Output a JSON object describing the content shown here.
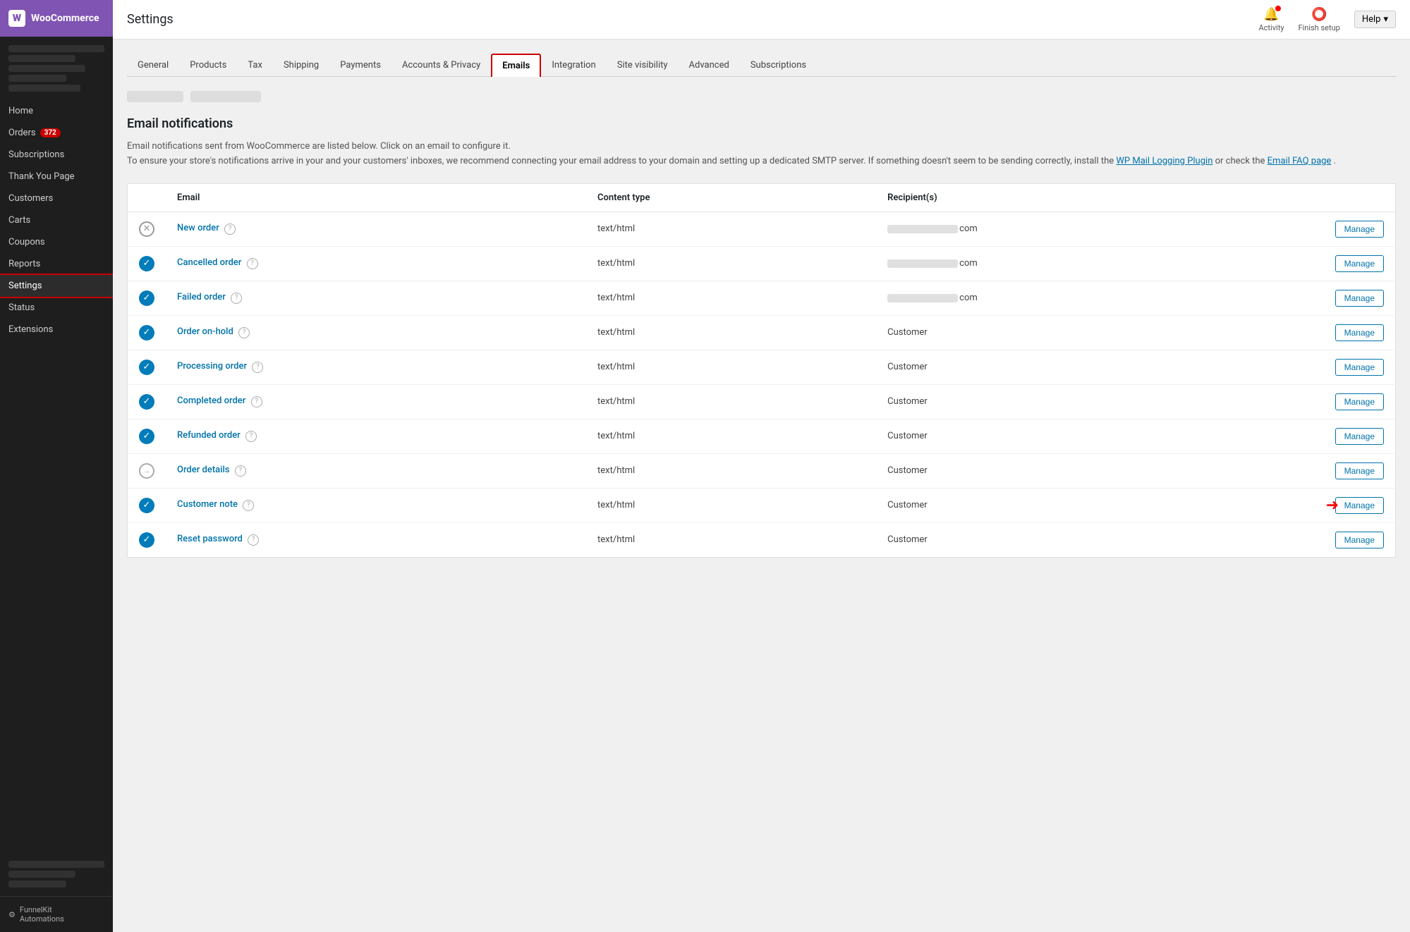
{
  "sidebar": {
    "logo_label": "WooCommerce",
    "logo_initial": "W",
    "nav_items": [
      {
        "id": "home",
        "label": "Home",
        "active": false
      },
      {
        "id": "orders",
        "label": "Orders",
        "badge": "372",
        "active": false
      },
      {
        "id": "subscriptions",
        "label": "Subscriptions",
        "active": false
      },
      {
        "id": "thank-you-page",
        "label": "Thank You Page",
        "active": false
      },
      {
        "id": "customers",
        "label": "Customers",
        "active": false
      },
      {
        "id": "carts",
        "label": "Carts",
        "active": false
      },
      {
        "id": "coupons",
        "label": "Coupons",
        "active": false
      },
      {
        "id": "reports",
        "label": "Reports",
        "active": false
      },
      {
        "id": "settings",
        "label": "Settings",
        "active": true,
        "settings": true
      },
      {
        "id": "status",
        "label": "Status",
        "active": false
      },
      {
        "id": "extensions",
        "label": "Extensions",
        "active": false
      }
    ],
    "footer_label": "FunnelKit Automations",
    "footer_icon": "⚙"
  },
  "topbar": {
    "title": "Settings",
    "activity_label": "Activity",
    "finish_setup_label": "Finish setup",
    "help_label": "Help"
  },
  "tabs": [
    {
      "id": "general",
      "label": "General",
      "active": false
    },
    {
      "id": "products",
      "label": "Products",
      "active": false
    },
    {
      "id": "tax",
      "label": "Tax",
      "active": false
    },
    {
      "id": "shipping",
      "label": "Shipping",
      "active": false
    },
    {
      "id": "payments",
      "label": "Payments",
      "active": false
    },
    {
      "id": "accounts-privacy",
      "label": "Accounts & Privacy",
      "active": false
    },
    {
      "id": "emails",
      "label": "Emails",
      "active": true
    },
    {
      "id": "integration",
      "label": "Integration",
      "active": false
    },
    {
      "id": "site-visibility",
      "label": "Site visibility",
      "active": false
    },
    {
      "id": "advanced",
      "label": "Advanced",
      "active": false
    },
    {
      "id": "subscriptions-tab",
      "label": "Subscriptions",
      "active": false
    }
  ],
  "section": {
    "title": "Email notifications",
    "description_part1": "Email notifications sent from WooCommerce are listed below. Click on an email to configure it.",
    "description_part2": "To ensure your store's notifications arrive in your and your customers' inboxes, we recommend connecting your email address to your domain and setting up a dedicated SMTP server. If something doesn't seem to be sending correctly, install the ",
    "link1_text": "WP Mail Logging Plugin",
    "description_part3": " or check the ",
    "link2_text": "Email FAQ page",
    "description_part4": "."
  },
  "table": {
    "col_email": "Email",
    "col_content_type": "Content type",
    "col_recipients": "Recipient(s)",
    "rows": [
      {
        "id": "new-order",
        "status": "disabled",
        "name": "New order",
        "content_type": "text/html",
        "recipient": "blurred",
        "recipient_suffix": "com",
        "manage_label": "Manage"
      },
      {
        "id": "cancelled-order",
        "status": "enabled",
        "name": "Cancelled order",
        "content_type": "text/html",
        "recipient": "blurred",
        "recipient_suffix": "com",
        "manage_label": "Manage"
      },
      {
        "id": "failed-order",
        "status": "enabled",
        "name": "Failed order",
        "content_type": "text/html",
        "recipient": "blurred",
        "recipient_suffix": "com",
        "manage_label": "Manage"
      },
      {
        "id": "order-on-hold",
        "status": "enabled",
        "name": "Order on-hold",
        "content_type": "text/html",
        "recipient": "Customer",
        "recipient_suffix": "",
        "manage_label": "Manage"
      },
      {
        "id": "processing-order",
        "status": "enabled",
        "name": "Processing order",
        "content_type": "text/html",
        "recipient": "Customer",
        "recipient_suffix": "",
        "manage_label": "Manage"
      },
      {
        "id": "completed-order",
        "status": "enabled",
        "name": "Completed order",
        "content_type": "text/html",
        "recipient": "Customer",
        "recipient_suffix": "",
        "manage_label": "Manage"
      },
      {
        "id": "refunded-order",
        "status": "enabled",
        "name": "Refunded order",
        "content_type": "text/html",
        "recipient": "Customer",
        "recipient_suffix": "",
        "manage_label": "Manage"
      },
      {
        "id": "order-details",
        "status": "arrow",
        "name": "Order details",
        "content_type": "text/html",
        "recipient": "Customer",
        "recipient_suffix": "",
        "manage_label": "Manage"
      },
      {
        "id": "customer-note",
        "status": "enabled",
        "name": "Customer note",
        "content_type": "text/html",
        "recipient": "Customer",
        "recipient_suffix": "",
        "manage_label": "Manage",
        "has_red_arrow": true
      },
      {
        "id": "reset-password",
        "status": "enabled",
        "name": "Reset password",
        "content_type": "text/html",
        "recipient": "Customer",
        "recipient_suffix": "",
        "manage_label": "Manage"
      }
    ]
  }
}
